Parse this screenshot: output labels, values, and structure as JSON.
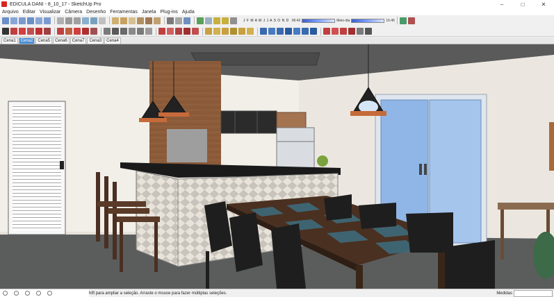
{
  "window": {
    "title": "EDICULA DANI - 8_10_17 - SketchUp Pro",
    "minimize": "–",
    "maximize": "□",
    "close": "✕"
  },
  "menu": [
    "Arquivo",
    "Editar",
    "Visualizar",
    "Câmera",
    "Desenho",
    "Ferramentas",
    "Janela",
    "Plug-ins",
    "Ajuda"
  ],
  "shadow_panel": {
    "months": "J F M A M J J A S O N D",
    "time_start": "06:43",
    "time_mid": "Meio-dia",
    "time_end": "16:45"
  },
  "scene_tabs": [
    {
      "label": "Cena1",
      "active": false
    },
    {
      "label": "Cena2",
      "active": true
    },
    {
      "label": "Cena5",
      "active": false
    },
    {
      "label": "Cena6",
      "active": false
    },
    {
      "label": "Cena7",
      "active": false
    },
    {
      "label": "Cena3",
      "active": false
    },
    {
      "label": "Cena4",
      "active": false
    }
  ],
  "status": {
    "hint": "hift para ampliar a seleção. Arraste o mouse para fazer múltiplas seleções.",
    "measure_label": "Medidas",
    "measure_value": ""
  },
  "colors": {
    "wall": "#f2efe9",
    "ceiling": "#5c5c5c",
    "floor": "#5a5c5c",
    "wood": "#8a5a3a",
    "dark_wood": "#4a3020",
    "glass": "#8fb6e6",
    "counter": "#1c1c1c",
    "active_tab": "#4a8fd8"
  }
}
